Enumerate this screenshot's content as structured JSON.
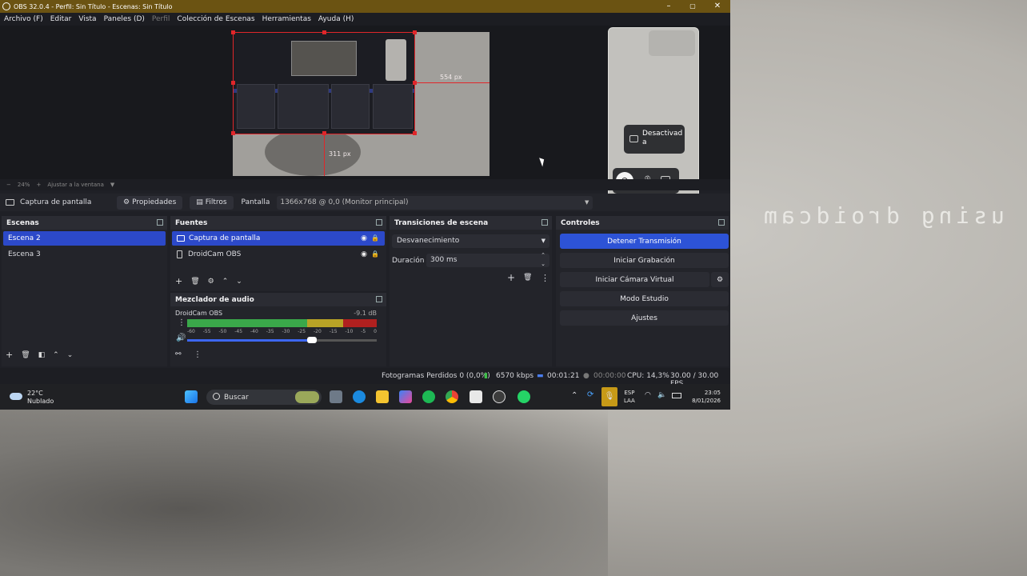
{
  "title_bar": {
    "title": "OBS 32.0.4 - Perfil: Sin Título - Escenas: Sin Título",
    "minimize": "–",
    "maximize": "▢",
    "close": "✕"
  },
  "menu": [
    "Archivo (F)",
    "Editar",
    "Vista",
    "Paneles (D)",
    "Perfil",
    "Colección de Escenas",
    "Herramientas",
    "Ayuda (H)"
  ],
  "preview": {
    "width_label": "554 px",
    "height_label": "311 px",
    "phone_toast": "Desactivad a"
  },
  "zoom": {
    "minus": "−",
    "level": "24%",
    "plus": "+",
    "fit": "Ajustar a la ventana",
    "menu": "▼"
  },
  "source_bar": {
    "source_name": "Captura de pantalla",
    "properties": "Propiedades",
    "filters": "Filtros",
    "display_label": "Pantalla",
    "display_value": "1366x768 @ 0,0 (Monitor principal)"
  },
  "scenes": {
    "title": "Escenas",
    "items": [
      "Escena 2",
      "Escena 3"
    ]
  },
  "sources": {
    "title": "Fuentes",
    "items": [
      "Captura de pantalla",
      "DroidCam OBS"
    ]
  },
  "mixer": {
    "title": "Mezclador de audio",
    "channel": "DroidCam OBS",
    "db": "-9.1 dB",
    "ticks": [
      "-60",
      "-55",
      "-50",
      "-45",
      "-40",
      "-35",
      "-30",
      "-25",
      "-20",
      "-15",
      "-10",
      "-5",
      "0"
    ],
    "volume_level": 0.66
  },
  "transitions": {
    "title": "Transiciones de escena",
    "type": "Desvanecimiento",
    "duration_label": "Duración",
    "duration_value": "300 ms"
  },
  "controls": {
    "title": "Controles",
    "buttons": [
      "Detener Transmisión",
      "Iniciar Grabación",
      "Iniciar Cámara Virtual",
      "Modo Estudio",
      "Ajustes"
    ]
  },
  "status": {
    "dropped": "Fotogramas Perdidos 0 (0,0%)",
    "bitrate": "6570 kbps",
    "stream_time": "00:01:21",
    "rec_time": "00:00:00",
    "cpu": "CPU: 14,3%",
    "fps": "30.00 / 30.00 FPS"
  },
  "taskbar": {
    "temp": "22°C",
    "weather": "Nublado",
    "search": "Buscar",
    "lang1": "ESP",
    "lang2": "LAA",
    "time": "23:05",
    "date": "8/01/2026"
  },
  "overlay_text": "using droidcam",
  "colors": {
    "accent": "#2c49c9",
    "titlebar": "#6b5312",
    "stream_button": "#2d53d6",
    "bounding_red": "#e0262a"
  }
}
